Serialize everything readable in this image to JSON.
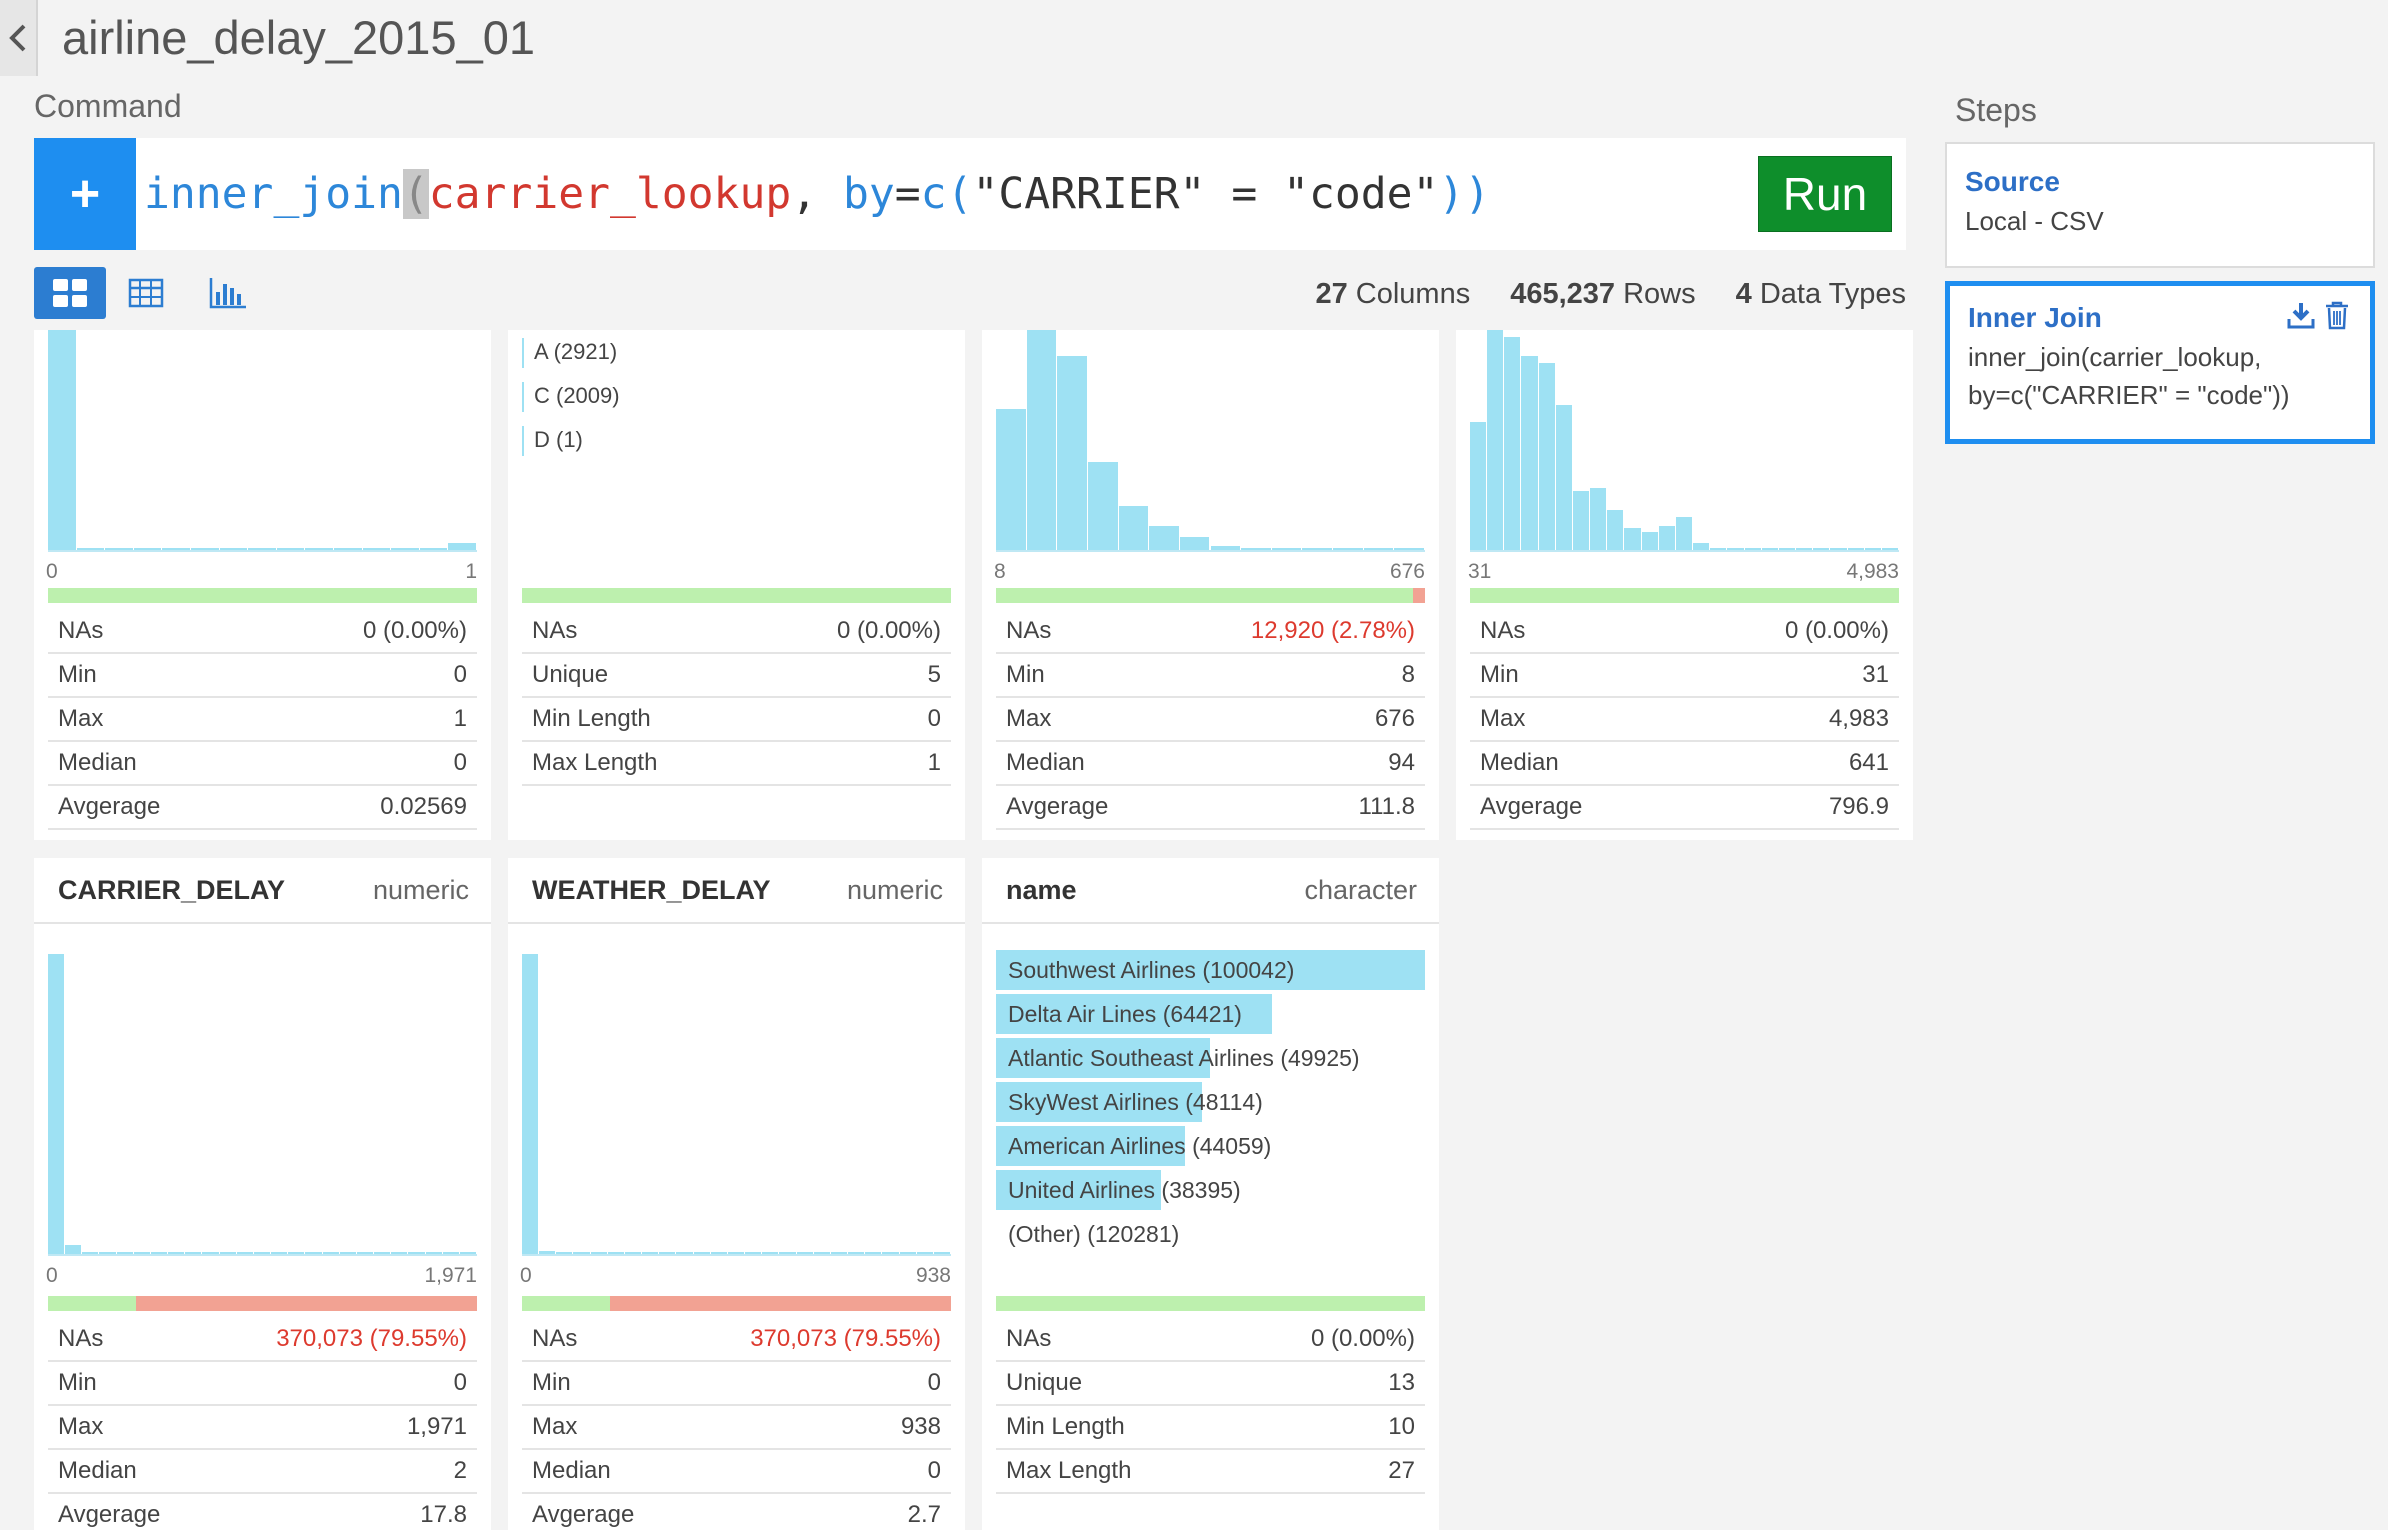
{
  "page": {
    "title": "airline_delay_2015_01",
    "command_label": "Command",
    "steps_label": "Steps"
  },
  "command": {
    "add_label": "+",
    "tokens": {
      "fn": "inner_join",
      "paren_open": "(",
      "arg1": "carrier_lookup",
      "comma": ", ",
      "param": "by",
      "eq": "=",
      "c_fn": "c",
      "c_open": "(",
      "str1": "\"CARRIER\"",
      "assign": " = ",
      "str2": "\"code\"",
      "close": "))"
    },
    "run_label": "Run"
  },
  "stats": {
    "columns_count": "27",
    "columns_label": "Columns",
    "rows_count": "465,237",
    "rows_label": "Rows",
    "types_count": "4",
    "types_label": "Data Types"
  },
  "cards_top": [
    {
      "axis_min": "0",
      "axis_max": "1",
      "histogram": [
        1.0,
        0,
        0,
        0,
        0,
        0,
        0,
        0,
        0,
        0,
        0,
        0,
        0,
        0,
        0.03
      ],
      "na_fraction": 0.0,
      "rows": [
        {
          "label": "NAs",
          "value": "0 (0.00%)"
        },
        {
          "label": "Min",
          "value": "0"
        },
        {
          "label": "Max",
          "value": "1"
        },
        {
          "label": "Median",
          "value": "0"
        },
        {
          "label": "Avgerage",
          "value": "0.02569"
        }
      ]
    },
    {
      "categories": [
        "A (2921)",
        "C (2009)",
        "D (1)"
      ],
      "na_fraction": 0.0,
      "rows": [
        {
          "label": "NAs",
          "value": "0 (0.00%)"
        },
        {
          "label": "Unique",
          "value": "5"
        },
        {
          "label": "Min Length",
          "value": "0"
        },
        {
          "label": "Max Length",
          "value": "1"
        }
      ]
    },
    {
      "axis_min": "8",
      "axis_max": "676",
      "histogram": [
        0.64,
        1.0,
        0.88,
        0.4,
        0.2,
        0.11,
        0.06,
        0.02,
        0.005,
        0.005,
        0.005,
        0.005,
        0.005,
        0.005
      ],
      "na_fraction": 0.0278,
      "rows": [
        {
          "label": "NAs",
          "value": "12,920 (2.78%)",
          "alert": true
        },
        {
          "label": "Min",
          "value": "8"
        },
        {
          "label": "Max",
          "value": "676"
        },
        {
          "label": "Median",
          "value": "94"
        },
        {
          "label": "Avgerage",
          "value": "111.8"
        }
      ]
    },
    {
      "axis_min": "31",
      "axis_max": "4,983",
      "histogram": [
        0.58,
        1.0,
        0.97,
        0.88,
        0.85,
        0.66,
        0.27,
        0.28,
        0.18,
        0.1,
        0.08,
        0.11,
        0.15,
        0.03,
        0.01,
        0.01,
        0.01,
        0.01,
        0.01,
        0.01,
        0.01,
        0.01,
        0.01,
        0.01,
        0.01
      ],
      "na_fraction": 0.0,
      "rows": [
        {
          "label": "NAs",
          "value": "0 (0.00%)"
        },
        {
          "label": "Min",
          "value": "31"
        },
        {
          "label": "Max",
          "value": "4,983"
        },
        {
          "label": "Median",
          "value": "641"
        },
        {
          "label": "Avgerage",
          "value": "796.9"
        }
      ]
    }
  ],
  "cards_bottom": [
    {
      "name": "CARRIER_DELAY",
      "type": "numeric",
      "axis_min": "0",
      "axis_max": "1,971",
      "histogram": [
        1.0,
        0.03,
        0.005,
        0.005,
        0.005,
        0.005,
        0.005,
        0.005,
        0.005,
        0.005,
        0.005,
        0.005,
        0.005,
        0.005,
        0.005,
        0.005,
        0.005,
        0.005,
        0.005,
        0.005,
        0.005,
        0.005,
        0.005,
        0.005,
        0.005
      ],
      "na_fraction": 0.7955,
      "rows": [
        {
          "label": "NAs",
          "value": "370,073 (79.55%)",
          "alert": true
        },
        {
          "label": "Min",
          "value": "0"
        },
        {
          "label": "Max",
          "value": "1,971"
        },
        {
          "label": "Median",
          "value": "2"
        },
        {
          "label": "Avgerage",
          "value": "17.8"
        }
      ]
    },
    {
      "name": "WEATHER_DELAY",
      "type": "numeric",
      "axis_min": "0",
      "axis_max": "938",
      "histogram": [
        1.0,
        0.01,
        0.005,
        0.005,
        0.005,
        0.005,
        0.005,
        0.005,
        0.005,
        0.005,
        0.005,
        0.005,
        0.005,
        0.005,
        0.005,
        0.005,
        0.005,
        0.005,
        0.005,
        0.005,
        0.005,
        0.005,
        0.005,
        0.005,
        0.005
      ],
      "na_fraction": 0.7955,
      "rows": [
        {
          "label": "NAs",
          "value": "370,073 (79.55%)",
          "alert": true
        },
        {
          "label": "Min",
          "value": "0"
        },
        {
          "label": "Max",
          "value": "938"
        },
        {
          "label": "Median",
          "value": "0"
        },
        {
          "label": "Avgerage",
          "value": "2.7"
        }
      ]
    },
    {
      "name": "name",
      "type": "character",
      "categories": [
        {
          "label": "Southwest Airlines (100042)",
          "fraction": 1.0
        },
        {
          "label": "Delta Air Lines (64421)",
          "fraction": 0.644
        },
        {
          "label": "Atlantic Southeast Airlines (49925)",
          "fraction": 0.499
        },
        {
          "label": "SkyWest Airlines (48114)",
          "fraction": 0.481
        },
        {
          "label": "American Airlines (44059)",
          "fraction": 0.44
        },
        {
          "label": "United Airlines (38395)",
          "fraction": 0.384
        },
        {
          "label": "(Other) (120281)",
          "fraction": 0.0
        }
      ],
      "na_fraction": 0.0,
      "rows": [
        {
          "label": "NAs",
          "value": "0 (0.00%)"
        },
        {
          "label": "Unique",
          "value": "13"
        },
        {
          "label": "Min Length",
          "value": "10"
        },
        {
          "label": "Max Length",
          "value": "27"
        }
      ]
    }
  ],
  "steps": [
    {
      "title": "Source",
      "desc": "Local - CSV"
    },
    {
      "title": "Inner Join",
      "desc": "inner_join(carrier_lookup,\nby=c(\"CARRIER\" = \"code\"))"
    }
  ],
  "icons": {
    "back": "chevron-left-icon",
    "summary": "grid-icon",
    "table": "table-icon",
    "chart": "bar-chart-icon",
    "download": "download-icon",
    "delete": "trash-icon"
  },
  "colors": {
    "accent": "#1e8ef0",
    "run": "#0e8e2b",
    "hist": "#9ee1f3",
    "na_ok": "#bdf0ae",
    "na_bad": "#f2a293",
    "alert_text": "#dd3a2e"
  }
}
